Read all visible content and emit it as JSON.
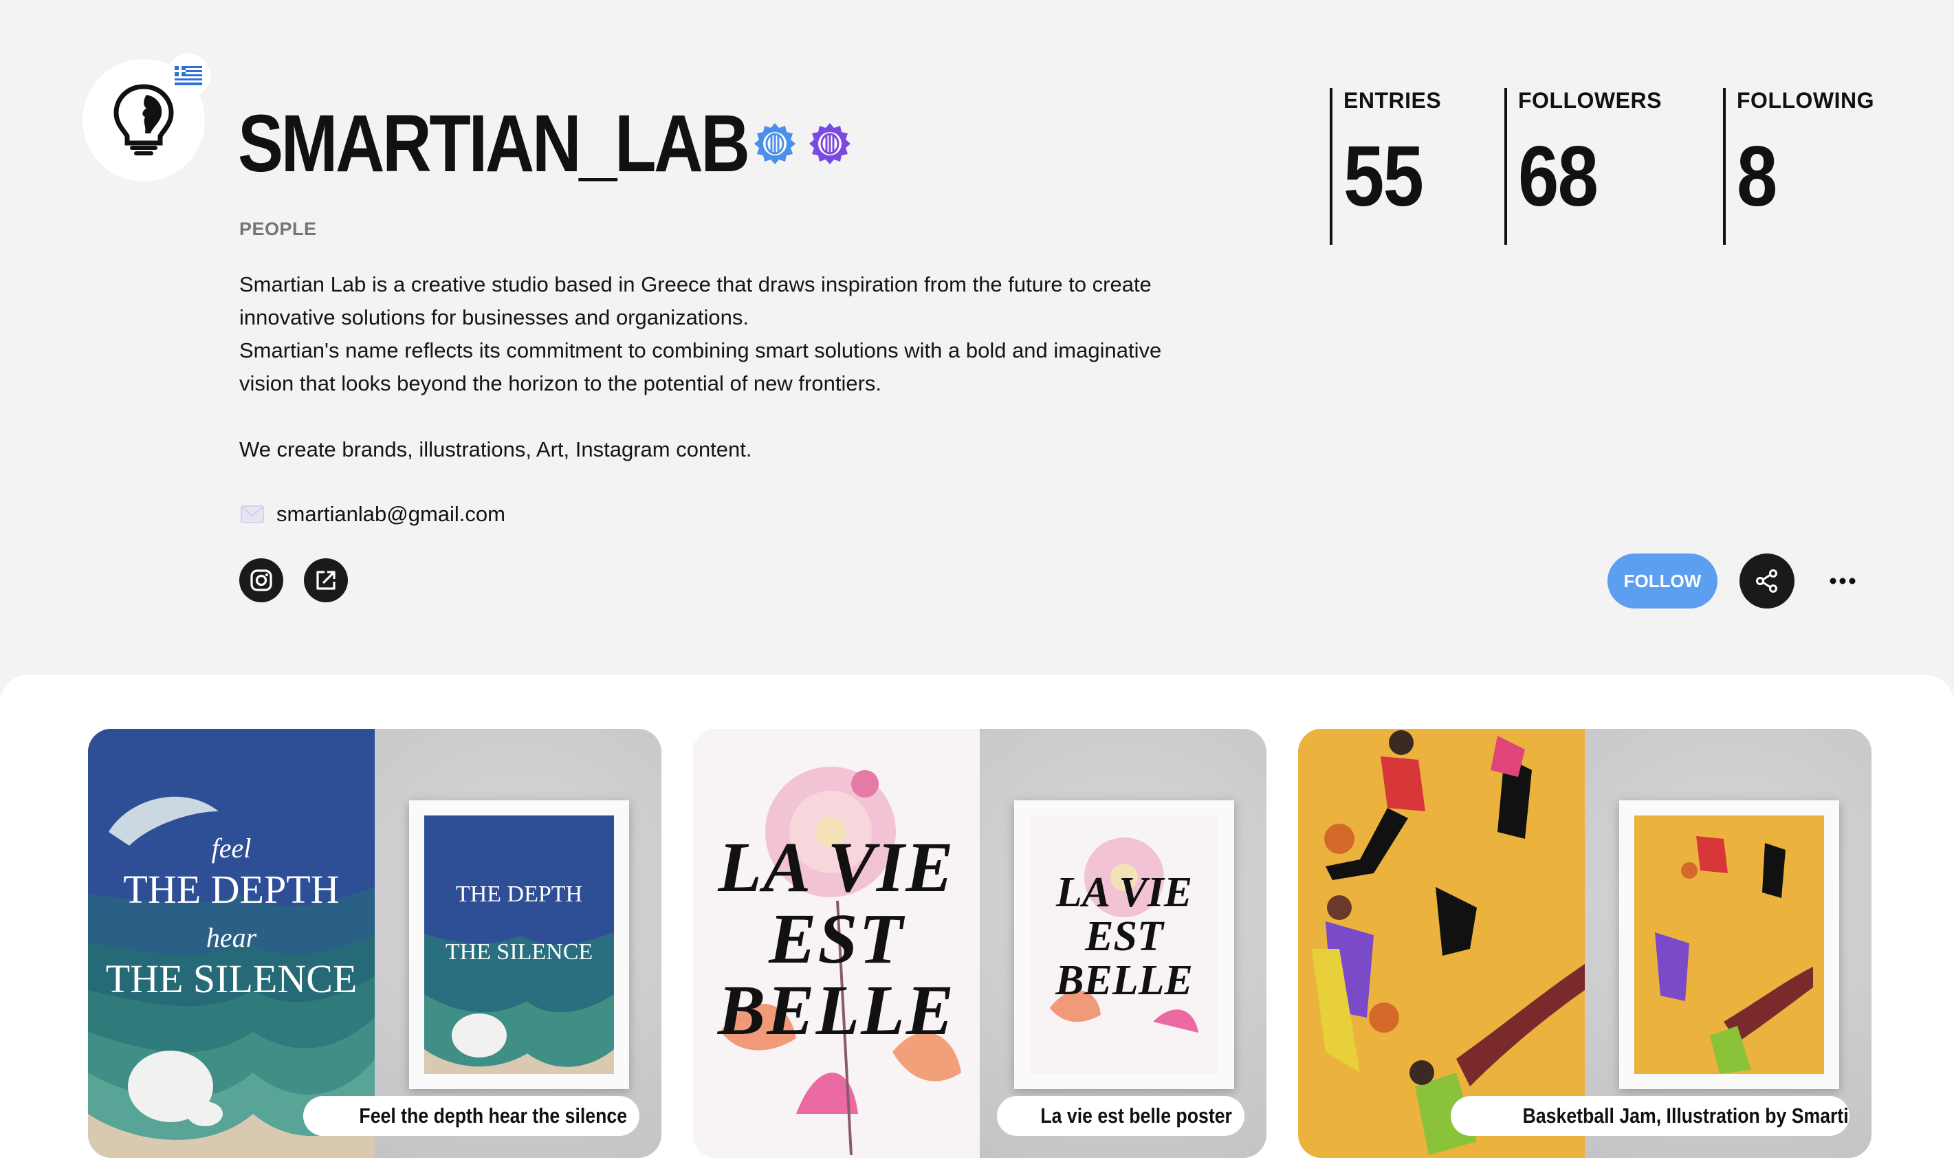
{
  "profile": {
    "username": "SMARTIAN_LAB",
    "category": "PEOPLE",
    "flag_icon": "greece-flag-icon",
    "avatar_icon": "lightbulb-head-icon",
    "badges": [
      {
        "icon": "verified-badge-icon",
        "color": "#4a90e8"
      },
      {
        "icon": "verified-badge-icon",
        "color": "#7a4ae0"
      }
    ],
    "bio": {
      "paragraph1": "Smartian Lab is a creative studio based in Greece that draws inspiration from the future to create\ninnovative solutions for businesses and organizations.\nSmartian's name reflects its commitment to combining smart solutions with a bold and imaginative\nvision that looks beyond the horizon to the potential of new frontiers.",
      "paragraph2": "We create brands, illustrations, Art, Instagram content."
    },
    "email": "smartianlab@gmail.com",
    "social_icons": [
      "instagram-icon",
      "external-link-icon"
    ]
  },
  "stats": {
    "entries": {
      "label": "ENTRIES",
      "value": "55"
    },
    "followers": {
      "label": "FOLLOWERS",
      "value": "68"
    },
    "following": {
      "label": "FOLLOWING",
      "value": "8"
    }
  },
  "actions": {
    "follow_label": "FOLLOW",
    "share_icon": "share-icon",
    "more_icon": "more-icon",
    "accent_color": "#5c9ef0"
  },
  "gallery": {
    "cards": [
      {
        "title": "Feel the depth hear the silence",
        "poster_lines": [
          "feel",
          "THE DEPTH",
          "hear",
          "THE SILENCE"
        ]
      },
      {
        "title": "La vie est belle poster",
        "poster_lines": [
          "LA VIE",
          "EST",
          "BELLE"
        ]
      },
      {
        "title": "Basketball Jam, Illustration by Smartian…"
      }
    ]
  }
}
